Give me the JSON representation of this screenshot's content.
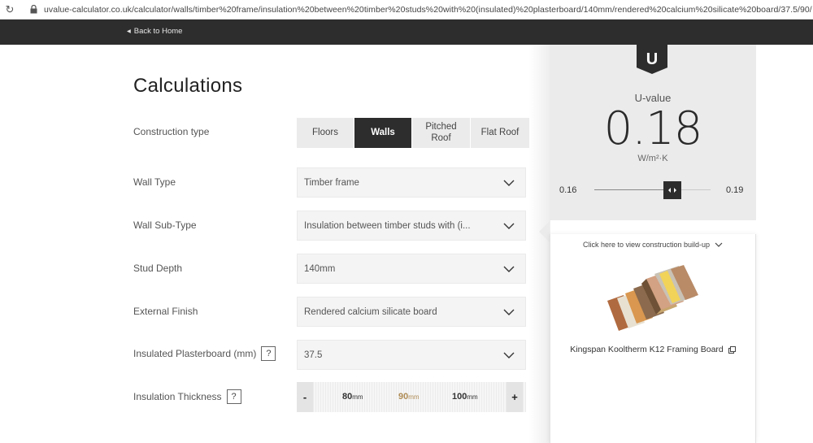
{
  "browser": {
    "url": "uvalue-calculator.co.uk/calculator/walls/timber%20frame/insulation%20between%20timber%20studs%20with%20(insulated)%20plasterboard/140mm/rendered%20calcium%20silicate%20board/37.5/90/"
  },
  "nav": {
    "back_label": "Back to Home"
  },
  "page": {
    "title": "Calculations"
  },
  "construction": {
    "label": "Construction type",
    "options": [
      "Floors",
      "Walls",
      "Pitched Roof",
      "Flat Roof"
    ],
    "selected": "Walls"
  },
  "fields": {
    "wall_type": {
      "label": "Wall Type",
      "value": "Timber frame"
    },
    "wall_sub_type": {
      "label": "Wall Sub-Type",
      "value": "Insulation between timber studs with (i..."
    },
    "stud_depth": {
      "label": "Stud Depth",
      "value": "140mm"
    },
    "external_finish": {
      "label": "External Finish",
      "value": "Rendered calcium silicate board"
    },
    "plasterboard": {
      "label": "Insulated Plasterboard (mm)",
      "help": "?",
      "value": "37.5"
    },
    "thickness": {
      "label": "Insulation Thickness",
      "help": "?",
      "minus": "-",
      "plus": "+",
      "ticks": [
        {
          "value": "80",
          "unit": "mm"
        },
        {
          "value": "90",
          "unit": "mm"
        },
        {
          "value": "100",
          "unit": "mm"
        }
      ],
      "selected": "90"
    }
  },
  "result": {
    "badge": "U",
    "label": "U-value",
    "value": "0.18",
    "unit": "W/m²·K",
    "range_min": "0.16",
    "range_max": "0.19",
    "range_position": 0.67
  },
  "product": {
    "buildup_link": "Click here to view construction build-up",
    "name": "Kingspan Kooltherm K12 Framing Board"
  }
}
